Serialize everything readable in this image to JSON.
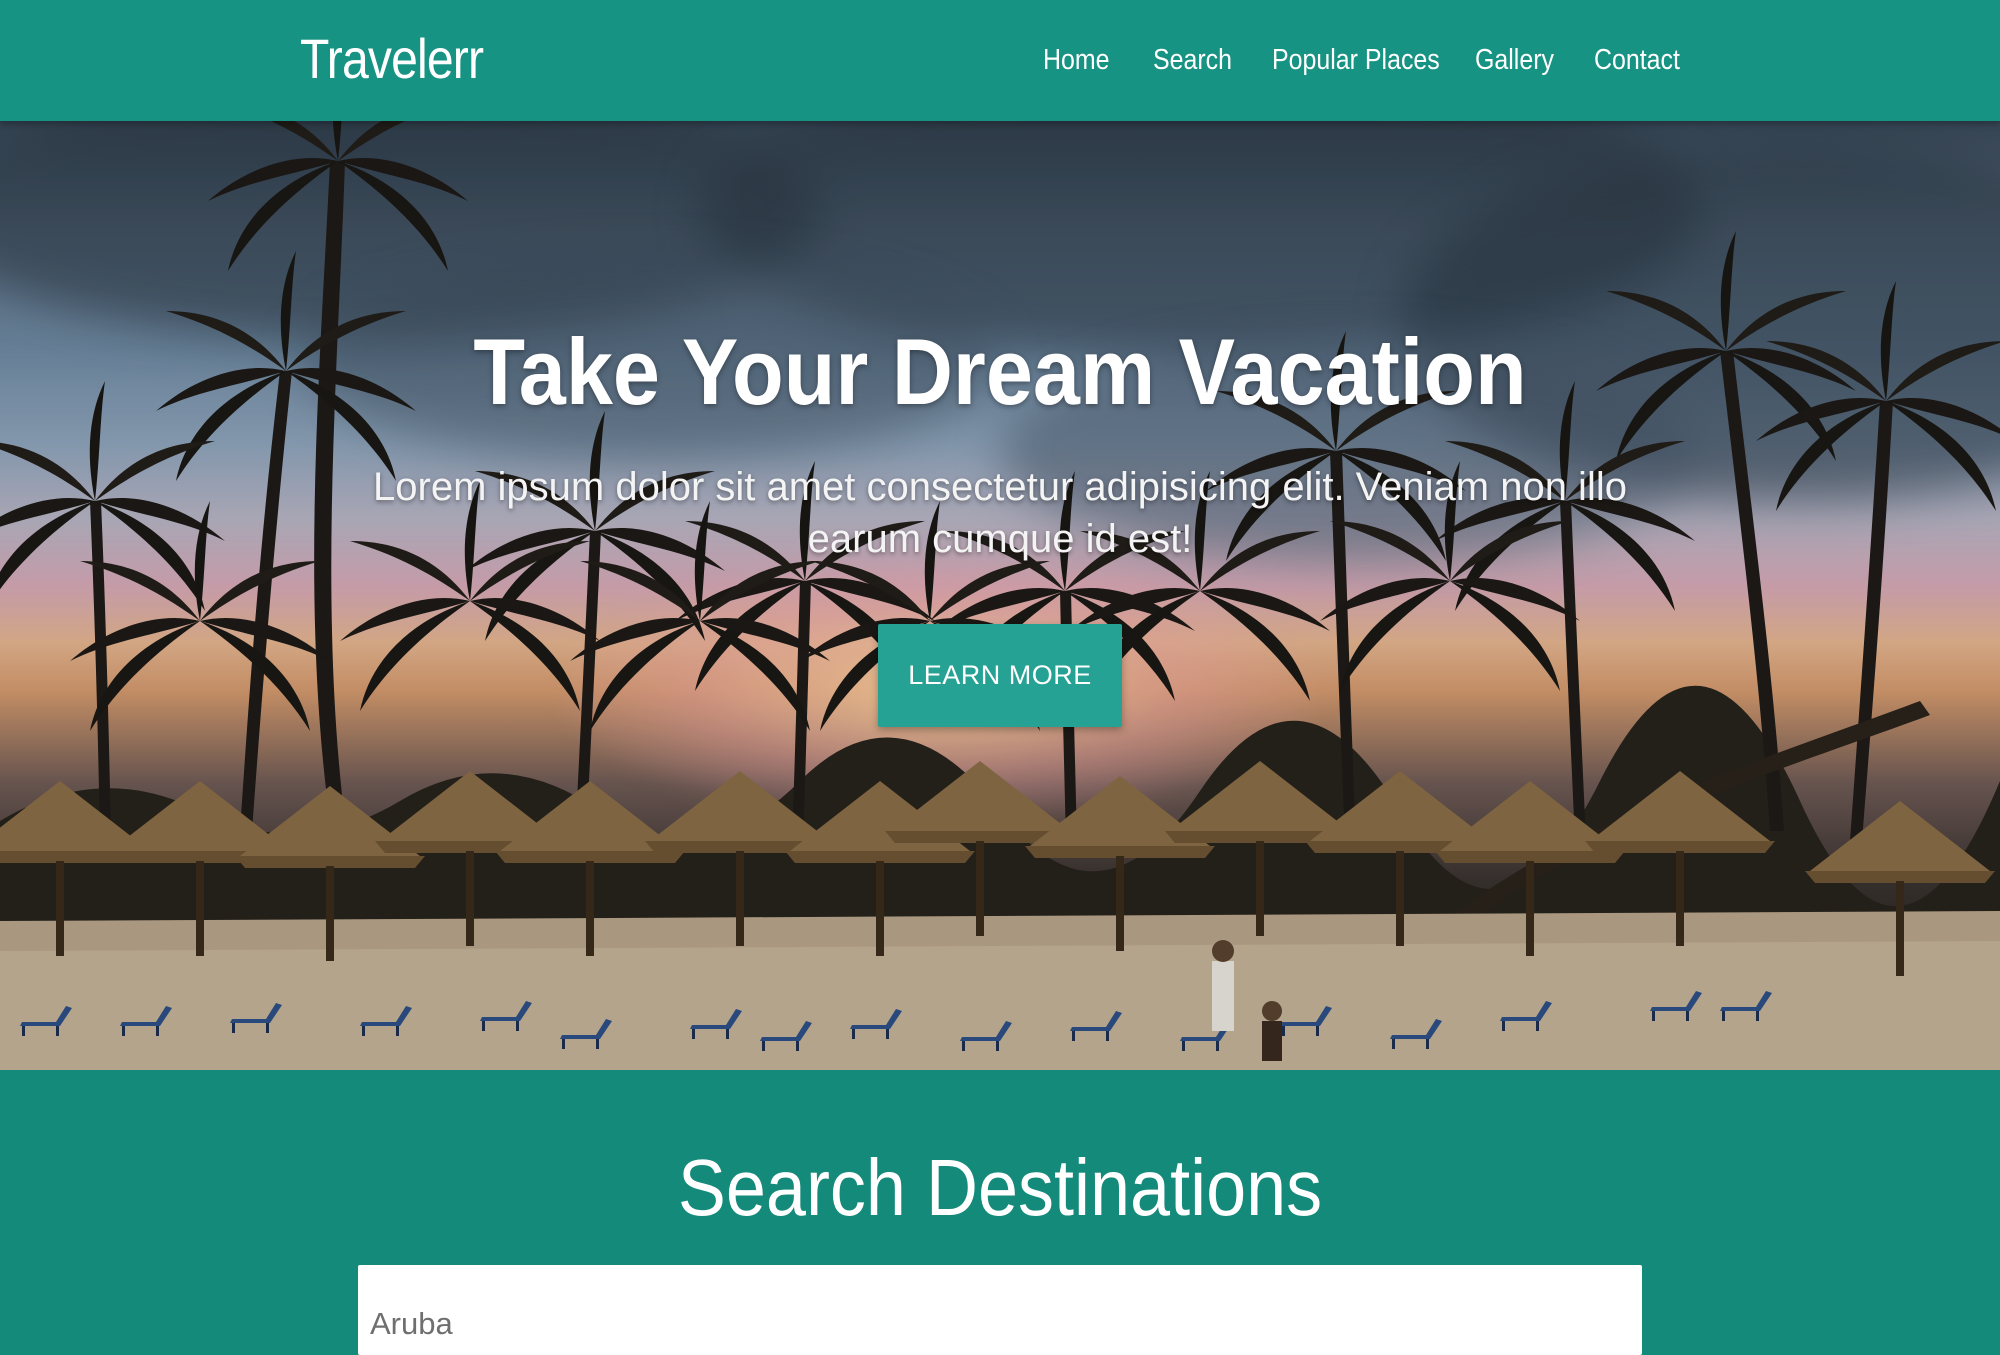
{
  "navbar": {
    "brand": "Travelerr",
    "links": [
      "Home",
      "Search",
      "Popular Places",
      "Gallery",
      "Contact"
    ]
  },
  "hero": {
    "title": "Take Your Dream Vacation",
    "subtitle": "Lorem ipsum dolor sit amet consectetur adipisicing elit. Veniam non illo earum cumque id est!",
    "button_label": "LEARN MORE"
  },
  "search": {
    "title": "Search Destinations",
    "input_value": "Aruba"
  },
  "colors": {
    "primary": "#169382",
    "section_bg": "#148a7a",
    "button": "#26a295"
  }
}
